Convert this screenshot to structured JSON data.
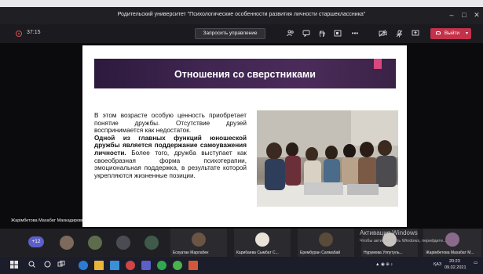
{
  "window": {
    "title": "Родительский университет \"Психологические особенности развития личности старшеклассника\"",
    "controls": [
      "–",
      "□",
      "✕"
    ]
  },
  "toolbar": {
    "timer": "37:15",
    "request_control_label": "Запросить управление",
    "leave_label": "Выйти",
    "icons": [
      "people-icon",
      "chat-icon",
      "raise-hand-icon",
      "rooms-icon",
      "more-icon",
      "camera-off-icon",
      "mic-off-icon",
      "share-icon"
    ]
  },
  "slide": {
    "title": "Отношения со сверстниками",
    "text_parts": {
      "p1": "В этом возрасте особую ценность приобретает понятие дружбы. Отсутствие друзей воспринимается как недостаток.",
      "p2_bold": "Одной из главных функций юношеской дружбы является поддержание самоуважения личности.",
      "p2_rest": " Более того, дружба выступает как своеобразная форма психотерапии, эмоциональная поддержка, в результате которой укрепляются жизненные позиции."
    }
  },
  "presenter": {
    "name": "Жарімбетова Махабат Махкадировна"
  },
  "participants": {
    "extra_count": "+12",
    "tiles": [
      {
        "name": "Ескуатан Марлабек"
      },
      {
        "name": "Карибаева Сымбат С..."
      },
      {
        "name": "Ерембуран Салмабай"
      },
      {
        "name": "Нурумова Улпутуль..."
      },
      {
        "name": "Жарімбетова Махабат М..."
      }
    ]
  },
  "os_watermark": {
    "title": "Активация Windows",
    "subtitle": "Чтобы активировать Windows, перейдите..."
  },
  "taskbar": {
    "tray_lang": "ҚАЗ",
    "tray_time": "20:23",
    "tray_date": "09.02.2021"
  }
}
